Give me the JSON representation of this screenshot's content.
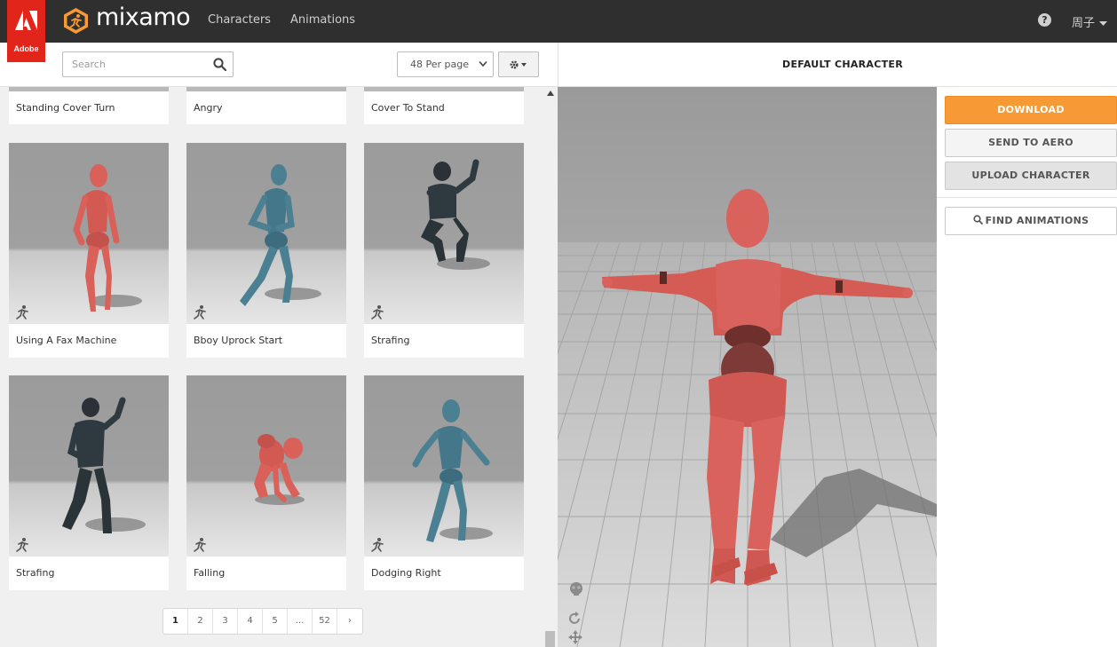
{
  "brand": {
    "adobe_label": "Adobe",
    "app_name": "mixamo",
    "accent_color": "#f79a36",
    "adobe_red": "#e1251b"
  },
  "nav": {
    "links": [
      "Characters",
      "Animations"
    ],
    "user_name": "周子"
  },
  "toolbar": {
    "search_placeholder": "Search",
    "per_page_value": "48 Per page"
  },
  "grid": {
    "top_row_labels": [
      "Standing Cover Turn",
      "Angry",
      "Cover To Stand"
    ],
    "cards": [
      {
        "label": "Using A Fax Machine",
        "figure": "red-mannequin"
      },
      {
        "label": "Bboy Uprock Start",
        "figure": "blue-mannequin"
      },
      {
        "label": "Strafing",
        "figure": "soldier"
      },
      {
        "label": "Strafing",
        "figure": "soldier"
      },
      {
        "label": "Falling",
        "figure": "red-mannequin"
      },
      {
        "label": "Dodging Right",
        "figure": "blue-mannequin"
      }
    ]
  },
  "pagination": {
    "pages": [
      "1",
      "2",
      "3",
      "4",
      "5",
      "...",
      "52",
      "›"
    ],
    "current": "1"
  },
  "viewer": {
    "title": "DEFAULT CHARACTER"
  },
  "actions": {
    "download": "DOWNLOAD",
    "send_to_aero": "SEND TO AERO",
    "upload_character": "UPLOAD CHARACTER",
    "find_animations": "FIND ANIMATIONS"
  }
}
